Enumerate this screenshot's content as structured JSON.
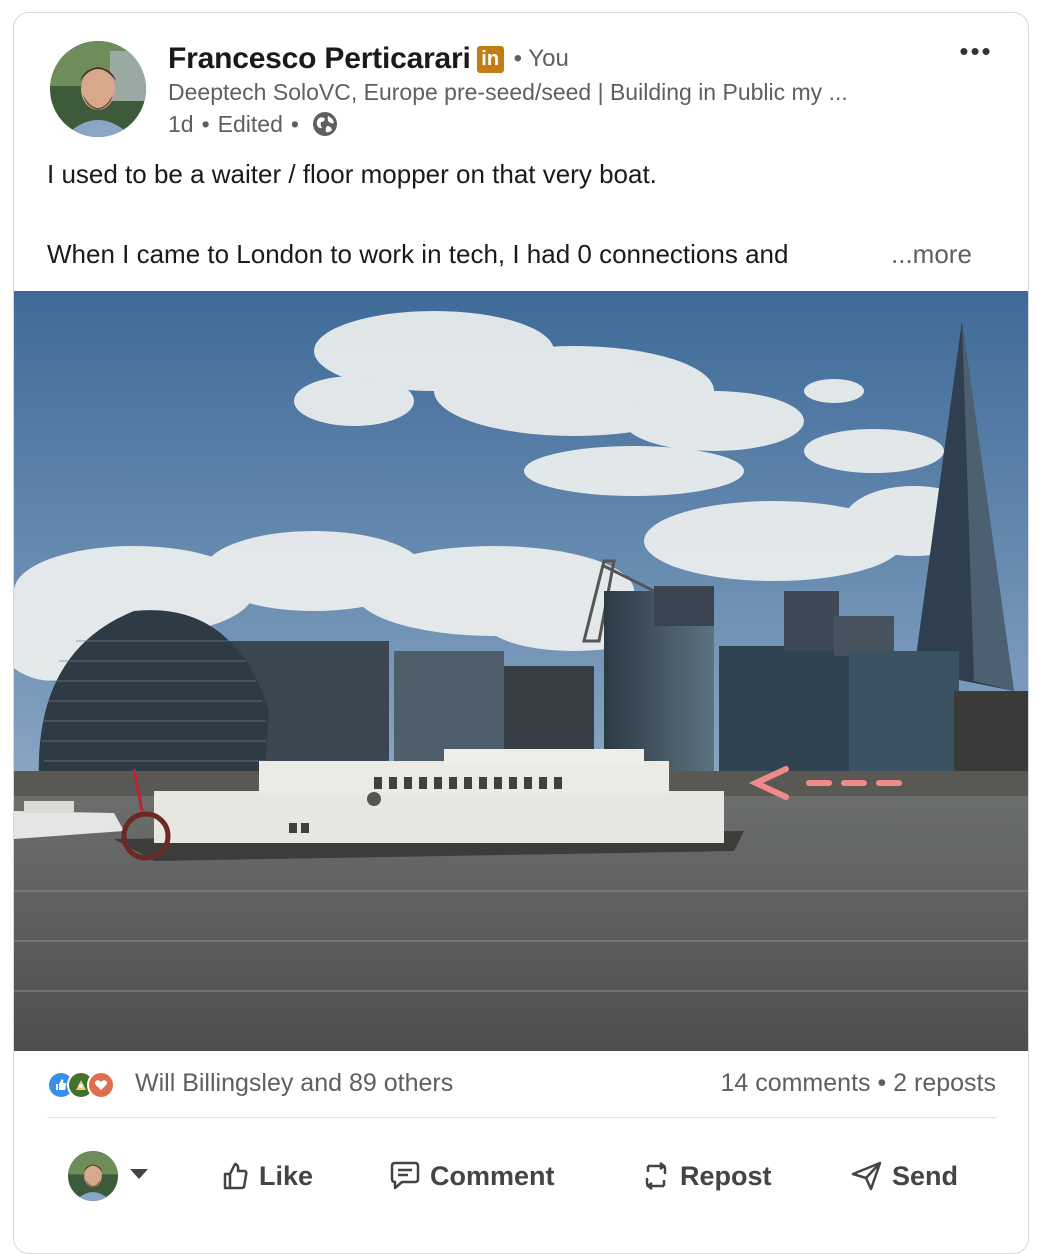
{
  "post": {
    "author": "Francesco Perticarari",
    "author_badge": "in",
    "degree": "• You",
    "headline": "Deeptech SoloVC, Europe pre-seed/seed | Building in Public my ...",
    "time": "1d",
    "edited": "Edited",
    "visibility_icon": "globe-icon",
    "menu_label": "•••",
    "text_line1": "I used to be a waiter / floor mopper on that very boat.",
    "text_line2": "When I came to London to work in tech, I had 0 connections and",
    "see_more": "...more",
    "photo_annotation": "<---"
  },
  "social": {
    "reactions": [
      "like-icon",
      "celebrate-icon",
      "love-icon"
    ],
    "reactors": "Will Billingsley and 89 others",
    "counts": "14 comments • 2 reposts"
  },
  "actions": {
    "like": "Like",
    "comment": "Comment",
    "repost": "Repost",
    "send": "Send"
  },
  "colors": {
    "badge": "#c37d16",
    "like_reaction": "#378fe9",
    "celebrate_reaction": "#44712e",
    "love_reaction": "#df704d",
    "arrow_annotation": "#f08a8a"
  }
}
